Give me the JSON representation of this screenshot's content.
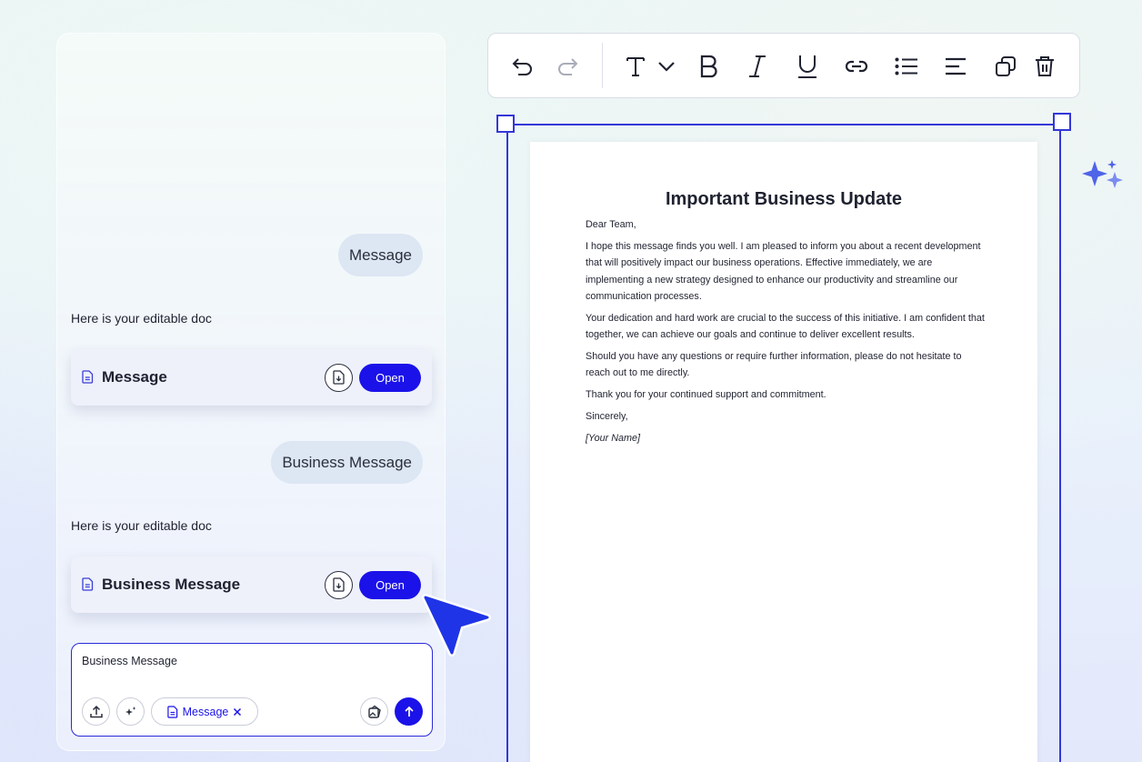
{
  "chat": {
    "messages": [
      {
        "role": "user",
        "text": "Message"
      },
      {
        "role": "assistant",
        "text": "Here is your editable doc"
      },
      {
        "role": "user",
        "text": "Business Message"
      },
      {
        "role": "assistant",
        "text": "Here is your editable doc"
      }
    ],
    "doc_cards": [
      {
        "title": "Message",
        "open_label": "Open",
        "download_icon": "download-file-icon"
      },
      {
        "title": "Business Message",
        "open_label": "Open",
        "download_icon": "download-file-icon"
      }
    ],
    "composer": {
      "value": "Business Message",
      "chip_label": "Message",
      "tools": [
        "upload-icon",
        "sparkle-icon",
        "gallery-icon",
        "send-arrow-icon"
      ]
    }
  },
  "toolbar": {
    "buttons": [
      "undo-icon",
      "redo-icon",
      "text-type-icon",
      "chevron-down-icon",
      "bold-icon",
      "italic-icon",
      "underline-icon",
      "link-icon",
      "bullet-list-icon",
      "align-left-icon",
      "duplicate-icon",
      "delete-icon"
    ]
  },
  "document": {
    "title": "Important Business Update",
    "paragraphs": [
      "Dear Team,",
      "I hope this message finds you well. I am pleased to inform you about a recent development that will positively impact our business operations. Effective immediately, we are implementing a new strategy designed to enhance our productivity and streamline our communication processes.",
      "Your dedication and hard work are crucial to the success of this initiative. I am confident that together, we can achieve our goals and continue to deliver excellent results.",
      "Should you have any questions or require further information, please do not hesitate to reach out to me directly.",
      "Thank you for your continued support and commitment.",
      "Sincerely,"
    ],
    "signature": "[Your Name]"
  },
  "colors": {
    "accent": "#1a12e8",
    "selection": "#3437d8",
    "bubble": "#dde6f3"
  }
}
